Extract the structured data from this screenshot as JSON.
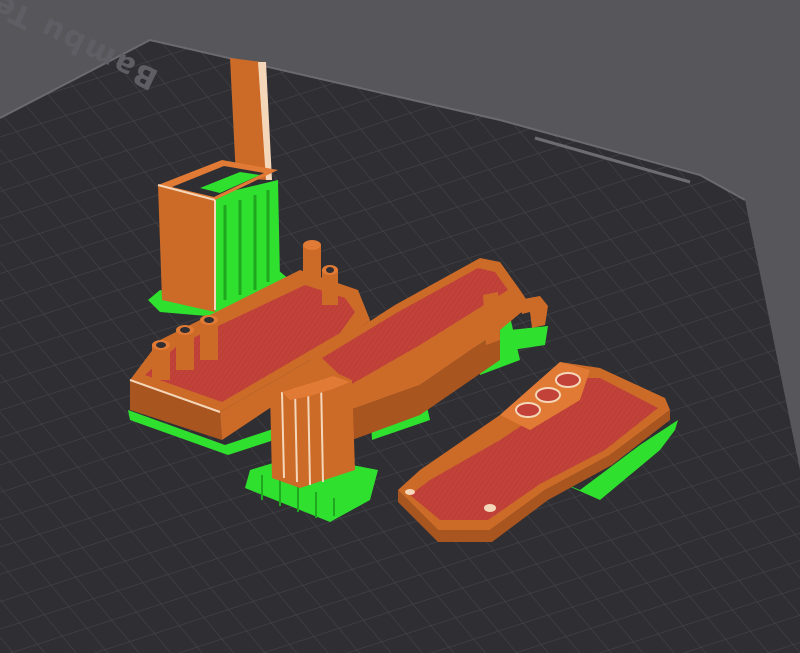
{
  "viewport": {
    "background_color": "#56565b"
  },
  "build_plate": {
    "label": "Bambu Text",
    "surface_color": "#2e2e33",
    "grid_color": "#45454b",
    "edge_color": "#6a6a70"
  },
  "colors": {
    "wall": "#cc6a28",
    "wall_light": "#e07a34",
    "wall_dark": "#a85520",
    "infill": "#c2423a",
    "support": "#2fe02f",
    "support_dark": "#1fa81f",
    "highlight": "#f4d6b8"
  },
  "parts": [
    {
      "id": "tall-box-part",
      "has_support": true
    },
    {
      "id": "left-tray-part",
      "has_support": true
    },
    {
      "id": "center-bracket-part",
      "has_support": true
    },
    {
      "id": "right-tray-part",
      "has_support": true
    }
  ]
}
